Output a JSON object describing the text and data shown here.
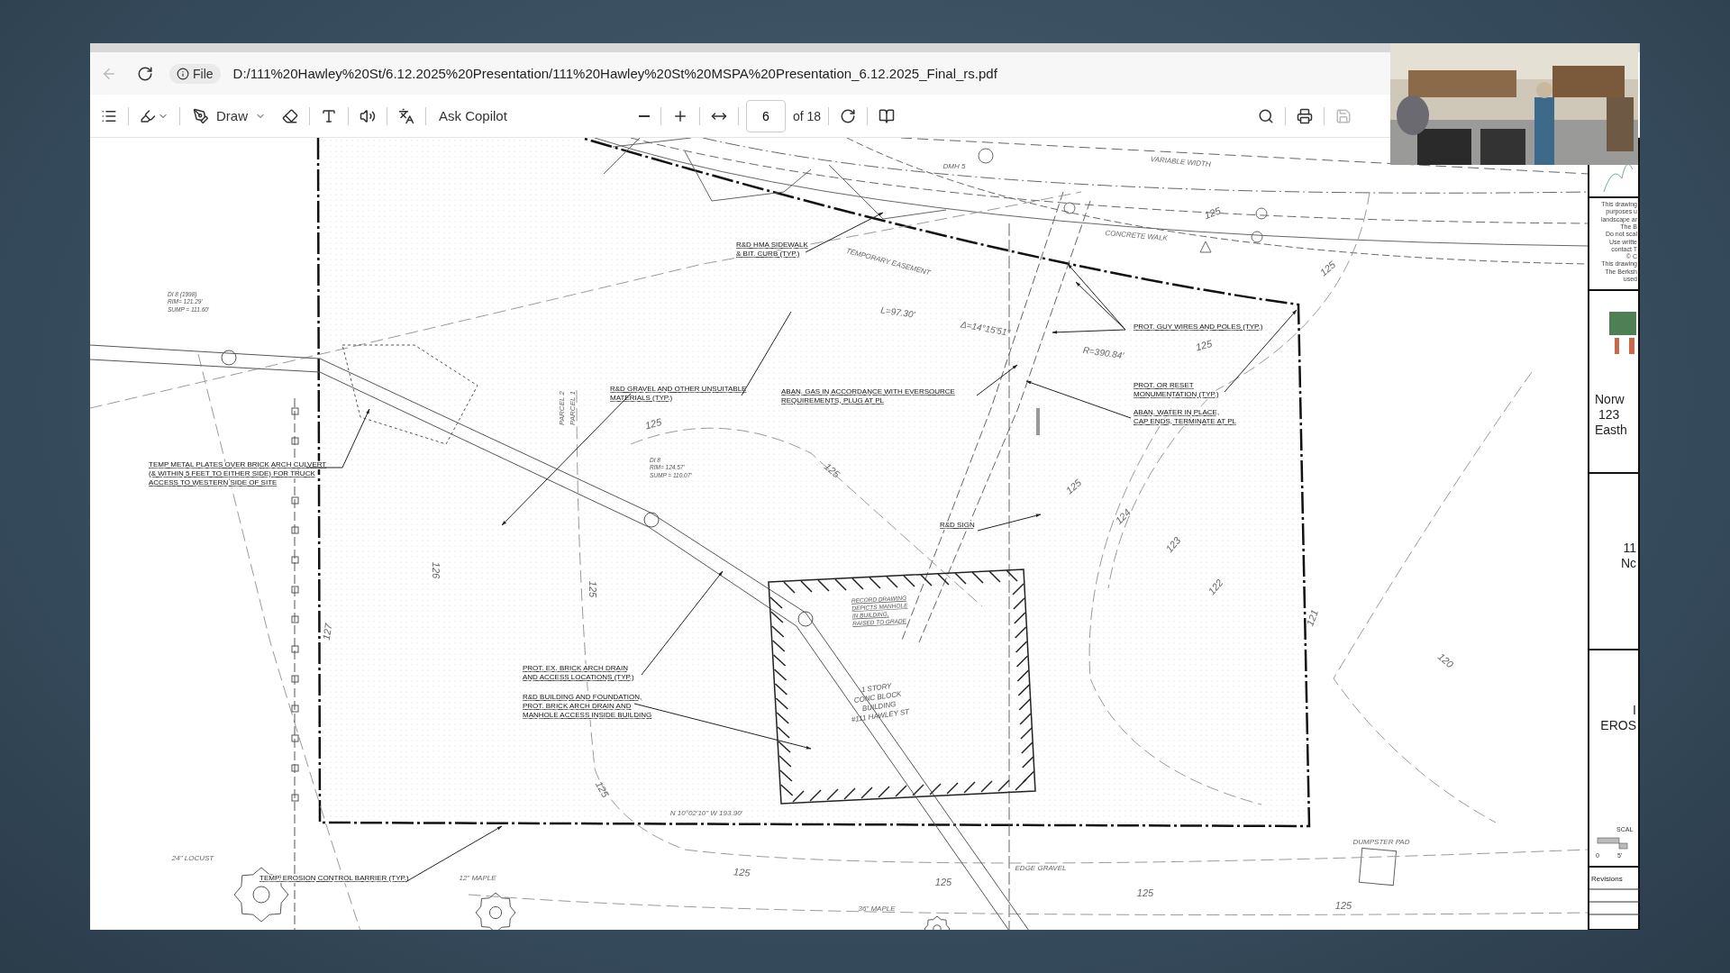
{
  "address_bar": {
    "back_disabled": true,
    "scheme": "File",
    "url": "D:/111%20Hawley%20St/6.12.2025%20Presentation/111%20Hawley%20St%20MSPA%20Presentation_6.12.2025_Final_rs.pdf"
  },
  "toolbar": {
    "draw_label": "Draw",
    "copilot_label": "Ask Copilot",
    "page": "6",
    "page_count": "of 18",
    "save_disabled": true
  },
  "drawing": {
    "callouts": [
      {
        "lines": [
          "R&D HMA SIDEWALK",
          "& BIT. CURB (TYP.)"
        ]
      },
      {
        "lines": [
          "PROT. GUY WIRES AND POLES (TYP.)"
        ]
      },
      {
        "lines": [
          "PROT. OR RESET",
          "MONUMENTATION (TYP.)"
        ]
      },
      {
        "lines": [
          "ABAN. WATER IN PLACE,",
          "CAP ENDS, TERMINATE AT PL"
        ]
      },
      {
        "lines": [
          "R&D  GRAVEL AND OTHER UNSUITABLE",
          "MATERIALS (TYP.)"
        ]
      },
      {
        "lines": [
          "ABAN. GAS IN ACCORDANCE WITH EVERSOURCE",
          "REQUIREMENTS, PLUG AT PL"
        ]
      },
      {
        "lines": [
          "TEMP METAL PLATES OVER BRICK ARCH CULVERT",
          "(& WITHIN 5 FEET TO EITHER SIDE) FOR TRUCK",
          "ACCESS TO WESTERN SIDE OF SITE"
        ]
      },
      {
        "lines": [
          "R&D SIGN"
        ]
      },
      {
        "lines": [
          "PROT. EX. BRICK ARCH DRAIN",
          "AND ACCESS LOCATIONS (TYP.)"
        ]
      },
      {
        "lines": [
          "R&D BUILDING AND FOUNDATION,",
          "PROT. BRICK ARCH DRAIN AND",
          "MANHOLE ACCESS INSIDE BUILDING"
        ]
      },
      {
        "lines": [
          "TEMP. EROSION CONTROL BARRIER (TYP.)"
        ]
      }
    ],
    "notes": [
      {
        "lines": [
          "DI 8 (1998)",
          "RIM= 121.29'",
          "SUMP = 111.60'"
        ]
      },
      {
        "lines": [
          "DI 8",
          "RIM= 124.57'",
          "SUMP = 110.07'"
        ]
      },
      {
        "lines": [
          "RECORD DRAWING",
          "DEPICTS MANHOLE",
          "IN BUILDING,",
          "RAISED TO GRADE"
        ]
      },
      {
        "lines": [
          "1 STORY",
          "CONC BLOCK",
          "BUILDING",
          "#111 HAWLEY ST"
        ]
      }
    ],
    "labels": [
      {
        "text": "VARIABLE WIDTH"
      },
      {
        "text": "DMH 5"
      },
      {
        "text": "CONCRETE WALK"
      },
      {
        "text": "TEMPORARY EASEMENT"
      },
      {
        "text": "L=97.30'"
      },
      {
        "text": "Δ=14°15'51\""
      },
      {
        "text": "R=390.84'"
      },
      {
        "text": "PARCEL 2"
      },
      {
        "text": "PARCEL 1"
      },
      {
        "text": "N 10°02'10\" W 193.90'"
      },
      {
        "text": "24\" LOCUST"
      },
      {
        "text": "12\" MAPLE"
      },
      {
        "text": "36\" MAPLE"
      },
      {
        "text": "EDGE GRAVEL"
      },
      {
        "text": "DUMPSTER PAD"
      },
      {
        "text": "125"
      },
      {
        "text": "125"
      },
      {
        "text": "125"
      },
      {
        "text": "125"
      },
      {
        "text": "125"
      },
      {
        "text": "125"
      },
      {
        "text": "125"
      },
      {
        "text": "125"
      },
      {
        "text": "125"
      },
      {
        "text": "125"
      },
      {
        "text": "125"
      },
      {
        "text": "125"
      },
      {
        "text": "124"
      },
      {
        "text": "123"
      },
      {
        "text": "122"
      },
      {
        "text": "121"
      },
      {
        "text": "120"
      },
      {
        "text": "126"
      },
      {
        "text": "127"
      }
    ]
  },
  "title_block": {
    "notes": [
      "This drawing",
      "purposes u",
      "landscape ar",
      "The B",
      "Do not scal",
      "Use writte",
      "contact T",
      "© C",
      "This drawing",
      "The Berksh",
      "used"
    ],
    "project": [
      "Norw",
      "123",
      "Easth"
    ],
    "sheet": [
      "11",
      "Nc"
    ],
    "title": [
      "I",
      "EROS"
    ],
    "scale": "SCAL",
    "scale_ticks": [
      "0",
      "5'"
    ],
    "revisions": "Revisions"
  }
}
